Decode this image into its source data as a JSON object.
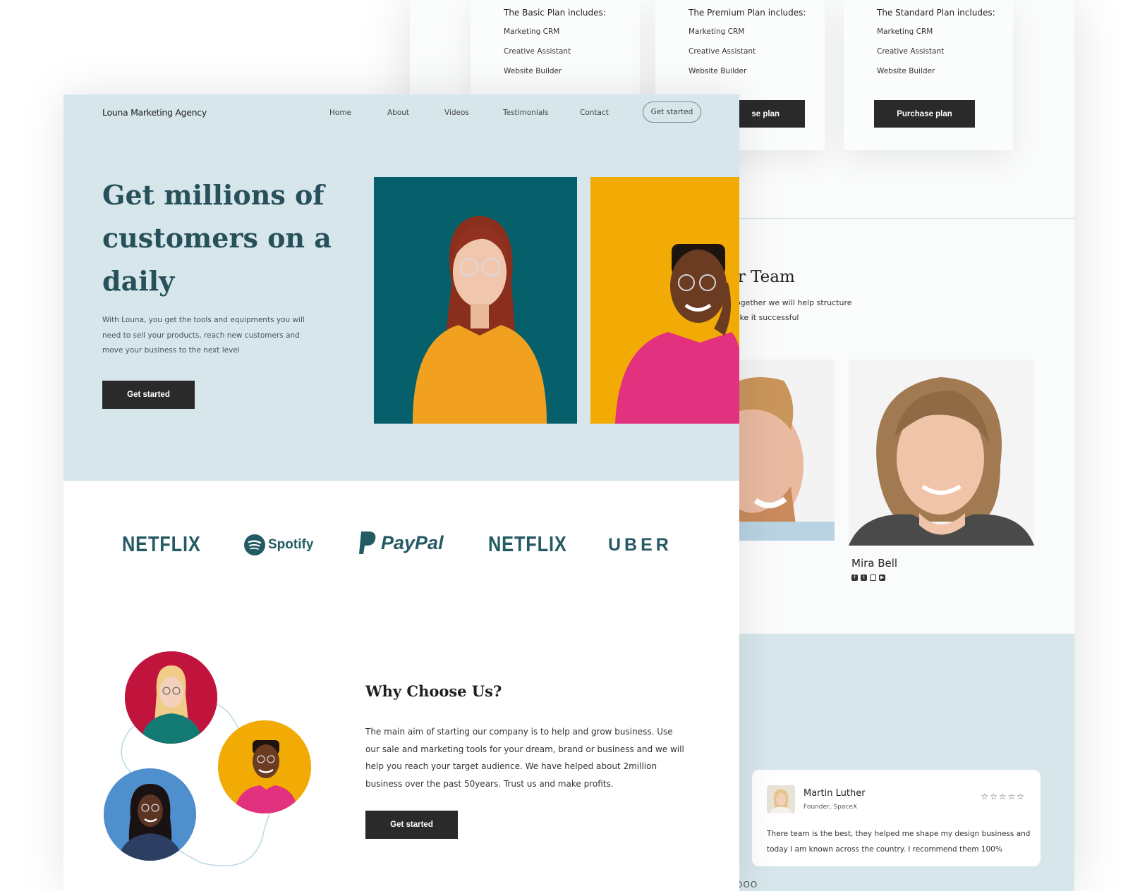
{
  "pricing": {
    "plans": [
      {
        "title": "The Basic Plan includes:",
        "features": [
          "Marketing CRM",
          "Creative Assistant",
          "Website Builder"
        ],
        "button": ""
      },
      {
        "title": "The Premium Plan includes:",
        "features": [
          "Marketing CRM",
          "Creative Assistant",
          "Website Builder"
        ],
        "button": "se plan"
      },
      {
        "title": "The Standard Plan includes:",
        "features": [
          "Marketing CRM",
          "Creative Assistant",
          "Website Builder"
        ],
        "button": "Purchase plan"
      }
    ]
  },
  "team": {
    "title": "ur Team",
    "desc_line1": ". Together we will help structure",
    "desc_line2": "make it successful",
    "member": {
      "name": "Mira Bell"
    }
  },
  "testimonial": {
    "name": "Martin Luther",
    "role": "Founder, SpaceX",
    "stars": "☆☆☆☆☆",
    "text": "There team is the best, they helped me shape my design business and today I am known across the country. I recommend them 100%",
    "dots": "OOO"
  },
  "header": {
    "brand": "Louna Marketing Agency",
    "nav": [
      "Home",
      "About",
      "Videos",
      "Testimonials",
      "Contact"
    ],
    "cta": "Get started"
  },
  "hero": {
    "headline": "Get millions of customers on a daily",
    "subtext": "With Louna, you get the tools and equipments you will need to sell your products, reach new customers and move your business to the next level",
    "button": "Get started"
  },
  "logos": [
    "NETFLIX",
    "Spotify",
    "PayPal",
    "NETFLIX",
    "UBER"
  ],
  "why": {
    "title": "Why Choose Us?",
    "text": "The main aim of starting our company is to help and grow business. Use our sale and marketing tools for your dream, brand or business and we will help you reach your target audience. We have helped about 2million business over the past 50years. Trust us and make profits.",
    "button": "Get started"
  },
  "colors": {
    "hero_bg": "#d6e6ea",
    "accent_teal": "#27505a",
    "photo_teal": "#06606b",
    "photo_yellow": "#f2ab05",
    "circle_red": "#c0143c",
    "circle_yellow": "#f2ab05",
    "circle_blue": "#4f8fce",
    "button_dark": "#2a2a2a"
  }
}
